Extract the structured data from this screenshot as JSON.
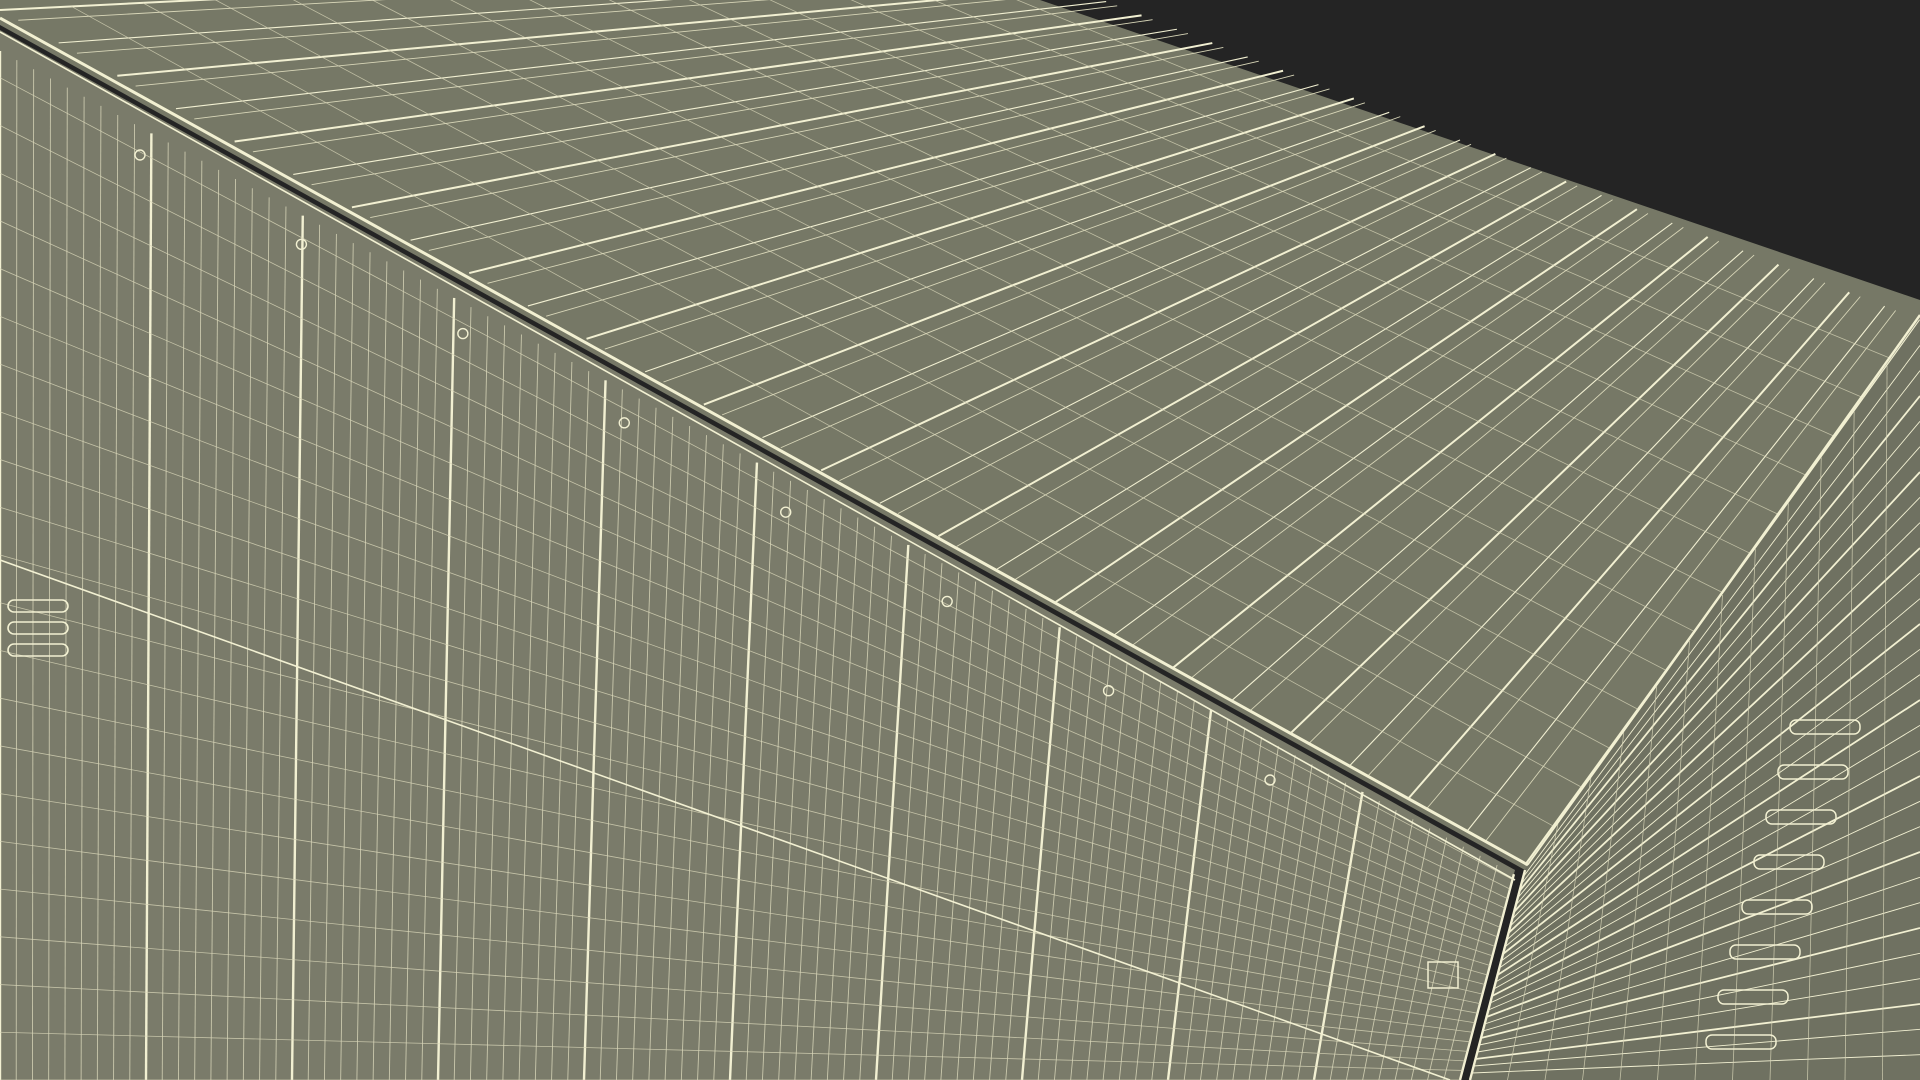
{
  "scene": {
    "subject": "boxcar-wireframe",
    "background_color": "#242424",
    "surface_color": "#7a7b6a",
    "top_color": "#767866",
    "end_color": "#6f7161",
    "wire_color": "#f2f0d2",
    "wire_faint": "#d8d6b8"
  }
}
